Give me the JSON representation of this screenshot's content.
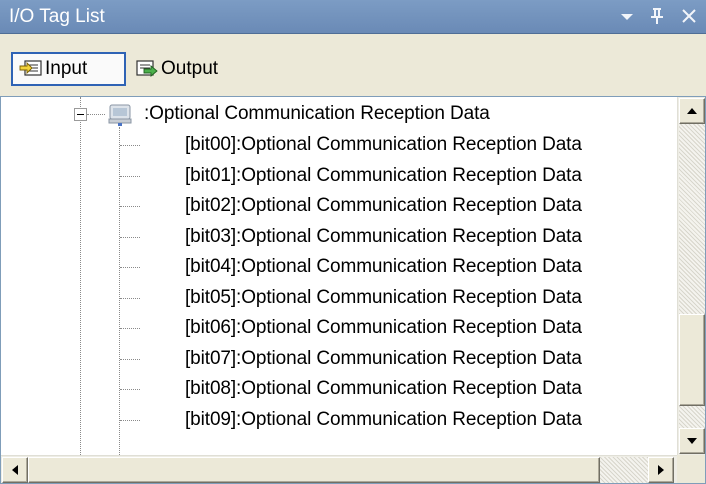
{
  "window": {
    "title": "I/O Tag List",
    "title_buttons": [
      "dropdown-arrow-icon",
      "pin-icon",
      "close-icon"
    ]
  },
  "toolbar": {
    "input_label": "Input",
    "output_label": "Output",
    "input_pressed": true
  },
  "tree": {
    "parent": {
      "label": ":Optional Communication Reception Data",
      "icon": "device-icon",
      "expanded": true
    },
    "children": [
      "[bit00]:Optional Communication Reception Data",
      "[bit01]:Optional Communication Reception Data",
      "[bit02]:Optional Communication Reception Data",
      "[bit03]:Optional Communication Reception Data",
      "[bit04]:Optional Communication Reception Data",
      "[bit05]:Optional Communication Reception Data",
      "[bit06]:Optional Communication Reception Data",
      "[bit07]:Optional Communication Reception Data",
      "[bit08]:Optional Communication Reception Data",
      "[bit09]:Optional Communication Reception Data"
    ]
  },
  "colors": {
    "titlebar": "#7c9cc4",
    "pressed_border": "#2f63b5",
    "panel_border": "#7f9db9"
  }
}
